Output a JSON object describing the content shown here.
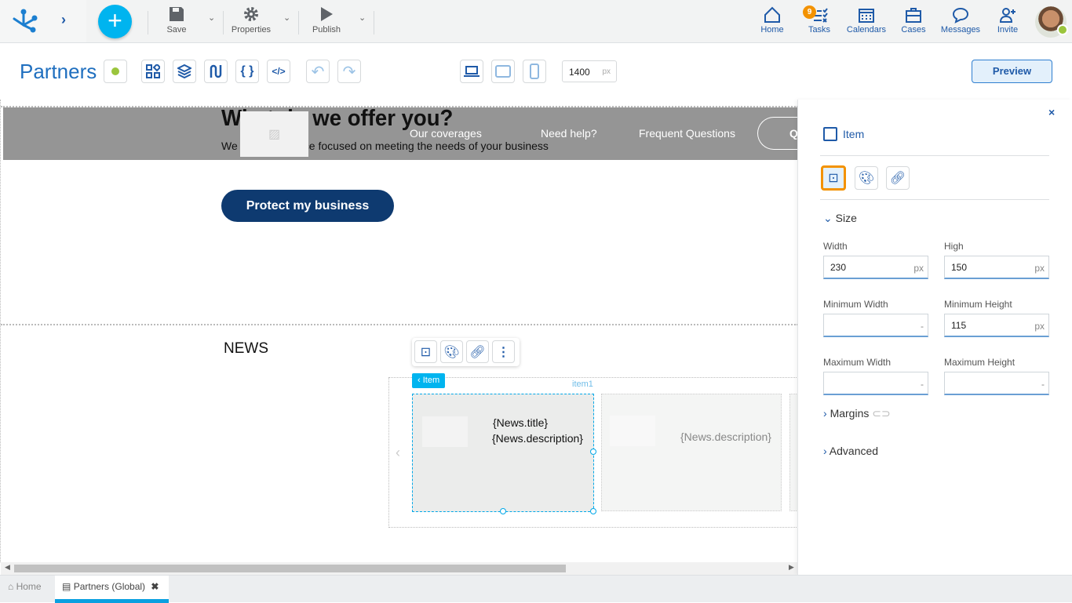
{
  "toolbar": {
    "save": "Save",
    "properties": "Properties",
    "publish": "Publish"
  },
  "nav": {
    "home": "Home",
    "tasks": "Tasks",
    "tasks_badge": "9",
    "calendars": "Calendars",
    "cases": "Cases",
    "messages": "Messages",
    "invite": "Invite"
  },
  "editor": {
    "title": "Partners",
    "width_value": "1400",
    "width_unit": "px",
    "preview": "Preview"
  },
  "canvas": {
    "banner_title": "What do we offer you?",
    "banner_subtitle": "We have insurance focused on meeting the needs of your business",
    "menu": [
      "Our coverages",
      "Need help?",
      "Frequent Questions",
      "Q"
    ],
    "cta": "Protect my business",
    "news_heading": "NEWS",
    "item_tag": "Item",
    "item_name": "item1",
    "news_title": "{News.title}",
    "news_description": "{News.description}",
    "news_description2": "{News.description}"
  },
  "panel": {
    "title": "Item",
    "size": "Size",
    "width_label": "Width",
    "width": "230",
    "high_label": "High",
    "high": "150",
    "min_width_label": "Minimum Width",
    "min_width": "-",
    "min_height_label": "Minimum Height",
    "min_height": "115",
    "max_width_label": "Maximum Width",
    "max_width": "-",
    "max_height_label": "Maximum Height",
    "max_height": "-",
    "unit": "px",
    "margins": "Margins",
    "advanced": "Advanced"
  },
  "tabs": {
    "home": "Home",
    "partners": "Partners (Global)"
  },
  "colors": {
    "accent": "#1f5aa8",
    "add": "#00b4ef",
    "selected": "#f39200",
    "status": "#9bc53d"
  }
}
